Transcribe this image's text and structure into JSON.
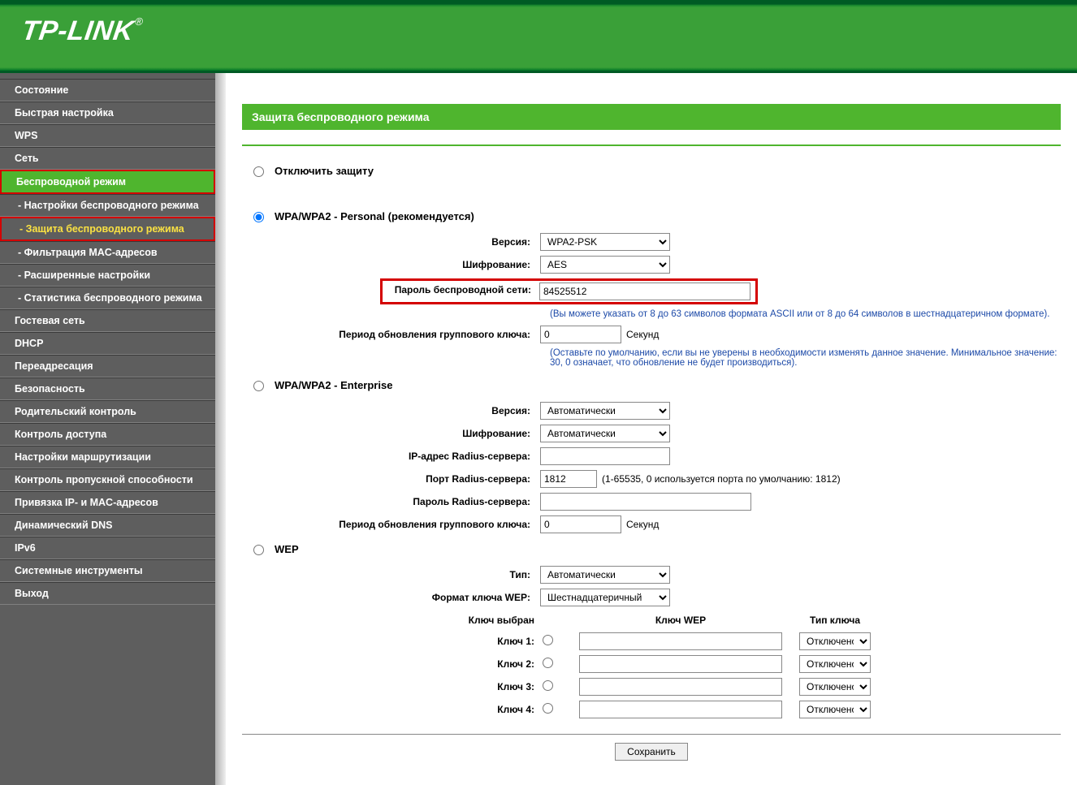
{
  "logo": "TP-LINK",
  "sidebar": {
    "items": [
      {
        "label": "Состояние"
      },
      {
        "label": "Быстрая настройка"
      },
      {
        "label": "WPS"
      },
      {
        "label": "Сеть"
      },
      {
        "label": "Беспроводной режим",
        "active": true,
        "red": true
      },
      {
        "label": "Гостевая сеть"
      },
      {
        "label": "DHCP"
      },
      {
        "label": "Переадресация"
      },
      {
        "label": "Безопасность"
      },
      {
        "label": "Родительский контроль"
      },
      {
        "label": "Контроль доступа"
      },
      {
        "label": "Настройки маршрутизации"
      },
      {
        "label": "Контроль пропускной способности"
      },
      {
        "label": "Привязка IP- и MAC-адресов"
      },
      {
        "label": "Динамический DNS"
      },
      {
        "label": "IPv6"
      },
      {
        "label": "Системные инструменты"
      },
      {
        "label": "Выход"
      }
    ],
    "subitems": [
      {
        "label": "- Настройки беспроводного режима"
      },
      {
        "label": "- Защита беспроводного режима",
        "active": true,
        "red": true
      },
      {
        "label": "- Фильтрация MAC-адресов"
      },
      {
        "label": "- Расширенные настройки"
      },
      {
        "label": "- Статистика беспроводного режима"
      }
    ]
  },
  "page": {
    "title": "Защита беспроводного режима",
    "disable_label": "Отключить защиту",
    "save": "Сохранить"
  },
  "personal": {
    "title": "WPA/WPA2 - Personal (рекомендуется)",
    "version_label": "Версия:",
    "version_value": "WPA2-PSK",
    "cipher_label": "Шифрование:",
    "cipher_value": "AES",
    "password_label": "Пароль беспроводной сети:",
    "password_value": "84525512",
    "password_note": "(Вы можете указать от 8 до 63 символов формата ASCII или от 8 до 64 символов в шестнадцатеричном формате).",
    "rekey_label": "Период обновления группового ключа:",
    "rekey_value": "0",
    "rekey_unit": "Секунд",
    "rekey_note": "(Оставьте по умолчанию, если вы не уверены в необходимости изменять данное значение. Минимальное значение: 30, 0 означает, что обновление не будет производиться)."
  },
  "enterprise": {
    "title": "WPA/WPA2 - Enterprise",
    "version_label": "Версия:",
    "version_value": "Автоматически",
    "cipher_label": "Шифрование:",
    "cipher_value": "Автоматически",
    "radius_ip_label": "IP-адрес Radius-сервера:",
    "radius_ip_value": "",
    "radius_port_label": "Порт Radius-сервера:",
    "radius_port_value": "1812",
    "radius_port_note": "(1-65535, 0 используется порта по умолчанию: 1812)",
    "radius_pass_label": "Пароль Radius-сервера:",
    "radius_pass_value": "",
    "rekey_label": "Период обновления группового ключа:",
    "rekey_value": "0",
    "rekey_unit": "Секунд"
  },
  "wep": {
    "title": "WEP",
    "type_label": "Тип:",
    "type_value": "Автоматически",
    "format_label": "Формат ключа WEP:",
    "format_value": "Шестнадцатеричный",
    "head_selected": "Ключ выбран",
    "head_key": "Ключ WEP",
    "head_type": "Тип ключа",
    "keys": [
      {
        "label": "Ключ 1:",
        "value": "",
        "type": "Отключено"
      },
      {
        "label": "Ключ 2:",
        "value": "",
        "type": "Отключено"
      },
      {
        "label": "Ключ 3:",
        "value": "",
        "type": "Отключено"
      },
      {
        "label": "Ключ 4:",
        "value": "",
        "type": "Отключено"
      }
    ]
  }
}
